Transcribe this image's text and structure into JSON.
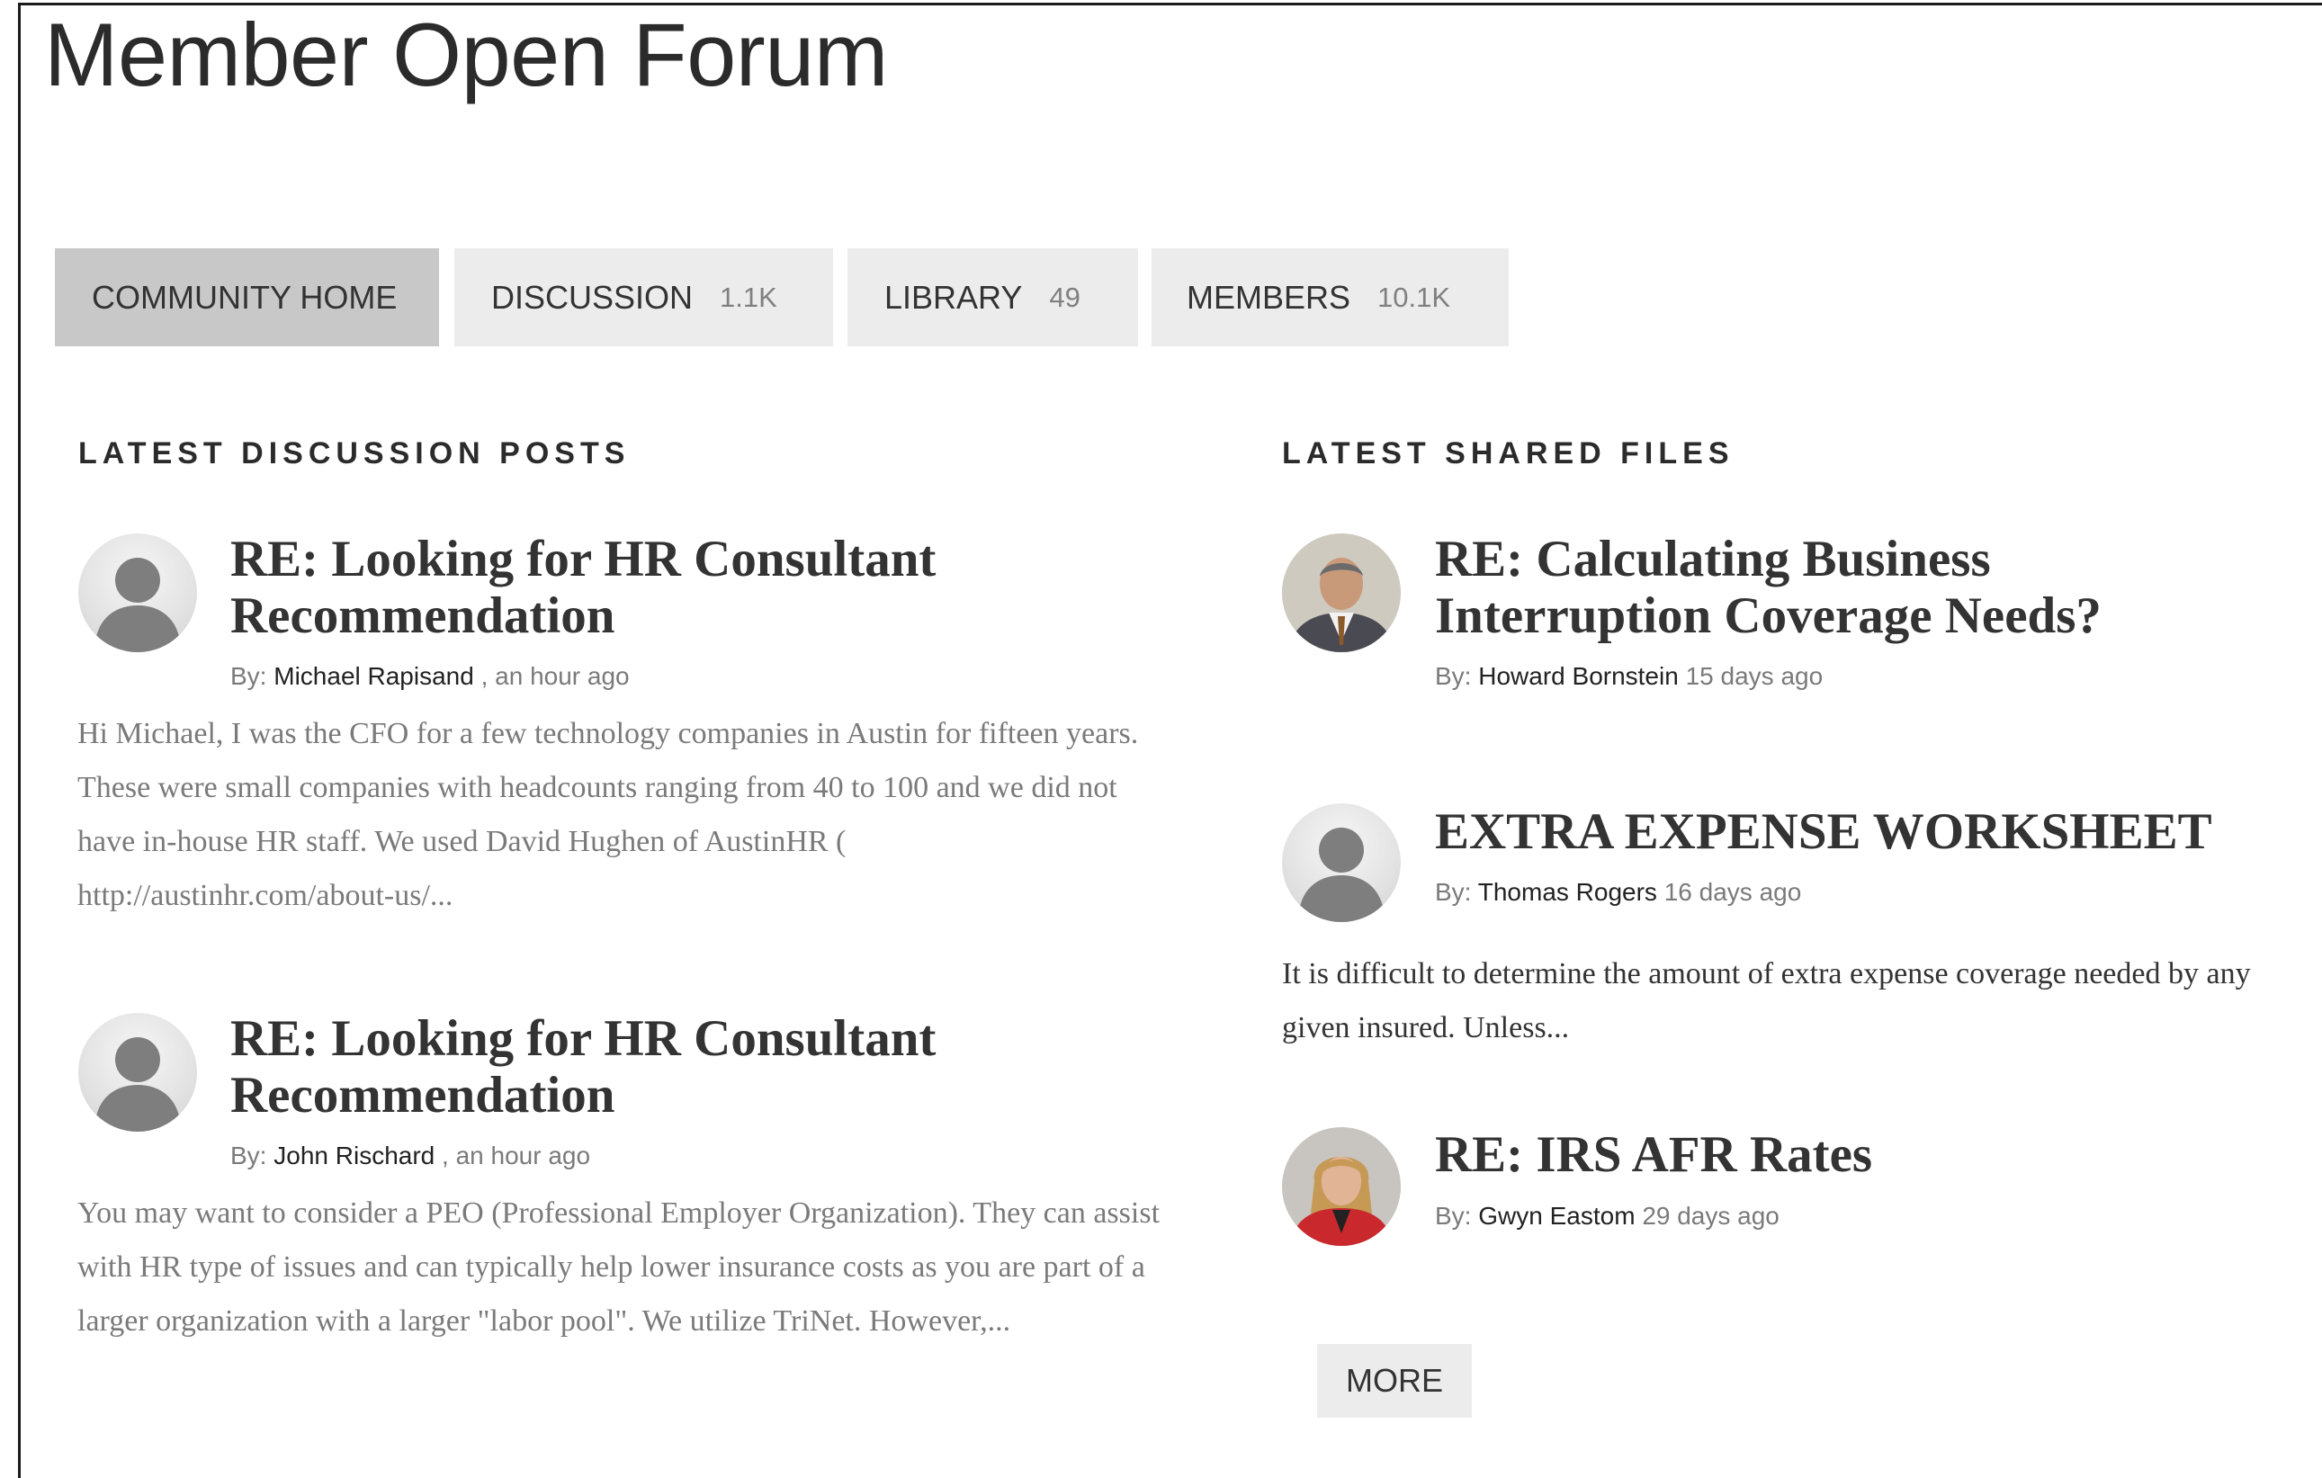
{
  "page": {
    "title": "Member Open Forum"
  },
  "tabs": [
    {
      "label": "COMMUNITY HOME",
      "count": ""
    },
    {
      "label": "DISCUSSION",
      "count": "1.1K"
    },
    {
      "label": "LIBRARY",
      "count": "49"
    },
    {
      "label": "MEMBERS",
      "count": "10.1K"
    }
  ],
  "discussion": {
    "heading": "LATEST DISCUSSION POSTS",
    "posts": [
      {
        "title": "RE: Looking for HR Consultant Recommendation",
        "by_label": "By:",
        "author": "Michael Rapisand",
        "time": ", an hour ago",
        "excerpt": "Hi Michael, I was the CFO for a few technology companies in Austin for fifteen years. These were small companies with headcounts ranging from 40 to 100 and we did not have in-house HR staff. We used David Hughen of AustinHR ( http://austinhr.com/about-us/...",
        "avatar": "default-person-icon"
      },
      {
        "title": "RE: Looking for HR Consultant Recommendation",
        "by_label": "By:",
        "author": "John Rischard",
        "time": ", an hour ago",
        "excerpt": "You may want to consider a PEO (Professional Employer Organization). They can assist with HR type of issues and can typically help lower insurance costs as you are part of a larger organization with a larger \"labor pool\". We utilize TriNet. However,...",
        "avatar": "default-person-icon"
      }
    ]
  },
  "files": {
    "heading": "LATEST SHARED FILES",
    "items": [
      {
        "title": "RE: Calculating Business Interruption Coverage Needs?",
        "by_label": "By:",
        "author": "Howard Bornstein",
        "time": "15 days ago",
        "excerpt": "",
        "avatar": "man-in-suit-photo"
      },
      {
        "title": "EXTRA EXPENSE WORKSHEET",
        "by_label": "By:",
        "author": "Thomas Rogers",
        "time": "16 days ago",
        "excerpt": "It is difficult to determine the amount of extra expense coverage needed by any given insured. Unless...",
        "avatar": "default-person-icon"
      },
      {
        "title": "RE: IRS AFR Rates",
        "by_label": "By:",
        "author": "Gwyn Eastom",
        "time": "29 days ago",
        "excerpt": "",
        "avatar": "woman-red-jacket-photo"
      }
    ],
    "more_label": "MORE"
  },
  "colors": {
    "tab_active": "#c8c8c8",
    "tab_inactive": "#ececec",
    "text_dark": "#333333",
    "text_muted": "#7a7a7a"
  }
}
